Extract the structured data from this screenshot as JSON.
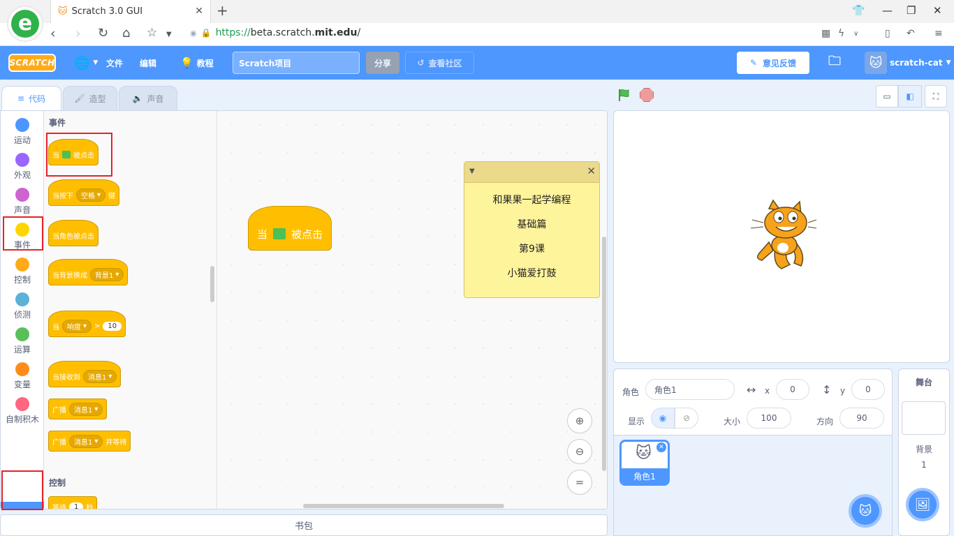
{
  "browser": {
    "tab_title": "Scratch 3.0 GUI",
    "url_proto": "https://",
    "url_sub": "beta.scratch.",
    "url_domain": "mit.edu",
    "url_path": "/"
  },
  "menubar": {
    "logo": "SCRATCH",
    "file": "文件",
    "edit": "编辑",
    "tutorials": "教程",
    "project_title": "Scratch项目",
    "share": "分享",
    "see_community": "查看社区",
    "feedback": "意见反馈",
    "username": "scratch-cat"
  },
  "tabs": {
    "code": "代码",
    "costumes": "造型",
    "sounds": "声音"
  },
  "categories": [
    {
      "label": "运动",
      "color": "#4c97ff"
    },
    {
      "label": "外观",
      "color": "#9966ff"
    },
    {
      "label": "声音",
      "color": "#cf63cf"
    },
    {
      "label": "事件",
      "color": "#ffd500"
    },
    {
      "label": "控制",
      "color": "#ffab19"
    },
    {
      "label": "侦测",
      "color": "#5cb1d6"
    },
    {
      "label": "运算",
      "color": "#59c059"
    },
    {
      "label": "变量",
      "color": "#ff8c1a"
    },
    {
      "label": "自制积木",
      "color": "#ff6680"
    }
  ],
  "palette": {
    "events_title": "事件",
    "when_flag": {
      "pre": "当",
      "post": "被点击"
    },
    "when_key": {
      "pre": "当按下",
      "key": "空格",
      "post": "键"
    },
    "when_sprite_clicked": "当角色被点击",
    "when_backdrop": {
      "pre": "当背景换成",
      "value": "背景1"
    },
    "when_greater": {
      "pre": "当",
      "value": "响度",
      "op": ">",
      "num": "10"
    },
    "when_receive": {
      "pre": "当接收到",
      "value": "消息1"
    },
    "broadcast": {
      "pre": "广播",
      "value": "消息1"
    },
    "broadcast_wait": {
      "pre": "广播",
      "value": "消息1",
      "post": "并等待"
    },
    "control_title": "控制",
    "wait": {
      "pre": "等待",
      "num": "1",
      "post": "秒"
    }
  },
  "script": {
    "pre": "当",
    "post": "被点击"
  },
  "note": {
    "line1": "和果果一起学编程",
    "line2": "基础篇",
    "line3": "第9课",
    "line4": "小猫爱打鼓"
  },
  "backpack": "书包",
  "sprite_info": {
    "sprite_label": "角色",
    "sprite_name": "角色1",
    "x_label": "x",
    "x": "0",
    "y_label": "y",
    "y": "0",
    "show_label": "显示",
    "size_label": "大小",
    "size": "100",
    "direction_label": "方向",
    "direction": "90"
  },
  "sprites": [
    {
      "name": "角色1"
    }
  ],
  "stage_panel": {
    "title": "舞台",
    "backdrop_label": "背景",
    "backdrop_count": "1"
  }
}
